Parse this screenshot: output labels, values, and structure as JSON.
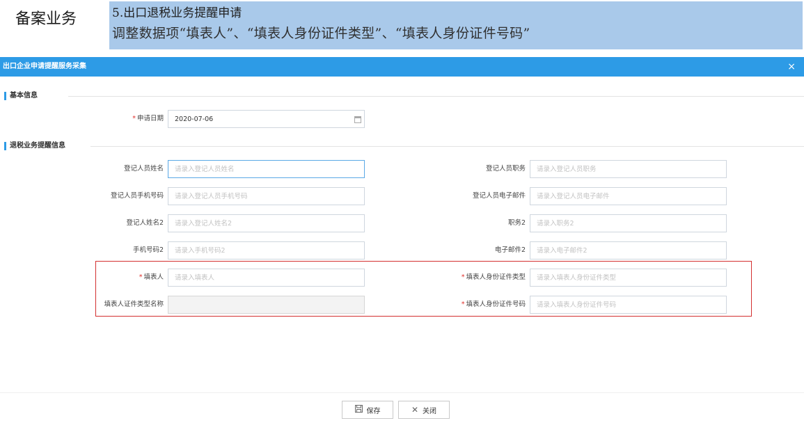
{
  "banner": {
    "category": "备案业务",
    "line1": "5.出口退税业务提醒申请",
    "line2": "调整数据项“填表人”、“填表人身份证件类型”、“填表人身份证件号码”"
  },
  "dialog": {
    "title": "出口企业申请提醒服务采集",
    "close_glyph": "×"
  },
  "sections": {
    "basic": "基本信息",
    "reminder": "退税业务提醒信息"
  },
  "basic": {
    "apply_date_label": "申请日期",
    "apply_date_value": "2020-07-06"
  },
  "fields": {
    "reg_name": {
      "label": "登记人员姓名",
      "placeholder": "请录入登记人员姓名"
    },
    "reg_title": {
      "label": "登记人员职务",
      "placeholder": "请录入登记人员职务"
    },
    "reg_phone": {
      "label": "登记人员手机号码",
      "placeholder": "请录入登记人员手机号码"
    },
    "reg_email": {
      "label": "登记人员电子邮件",
      "placeholder": "请录入登记人员电子邮件"
    },
    "reg_name2": {
      "label": "登记人姓名2",
      "placeholder": "请录入登记人姓名2"
    },
    "title2": {
      "label": "职务2",
      "placeholder": "请录入职务2"
    },
    "phone2": {
      "label": "手机号码2",
      "placeholder": "请录入手机号码2"
    },
    "email2": {
      "label": "电子邮件2",
      "placeholder": "请录入电子邮件2"
    },
    "filler": {
      "label": "填表人",
      "placeholder": "请录入填表人"
    },
    "filler_id_type": {
      "label": "填表人身份证件类型",
      "placeholder": "请录入填表人身份证件类型"
    },
    "filler_cert_name": {
      "label": "填表人证件类型名称",
      "value": ""
    },
    "filler_id_no": {
      "label": "填表人身份证件号码",
      "placeholder": "请录入填表人身份证件号码"
    }
  },
  "required_mark": "*",
  "buttons": {
    "save_label": "保存",
    "save_icon": "save-icon",
    "close_label": "关闭",
    "close_icon": "close-icon"
  },
  "colors": {
    "accent": "#2d9be6",
    "banner_bg": "#a9c9ea",
    "highlight": "#d32f2f",
    "required": "#e0302b"
  }
}
